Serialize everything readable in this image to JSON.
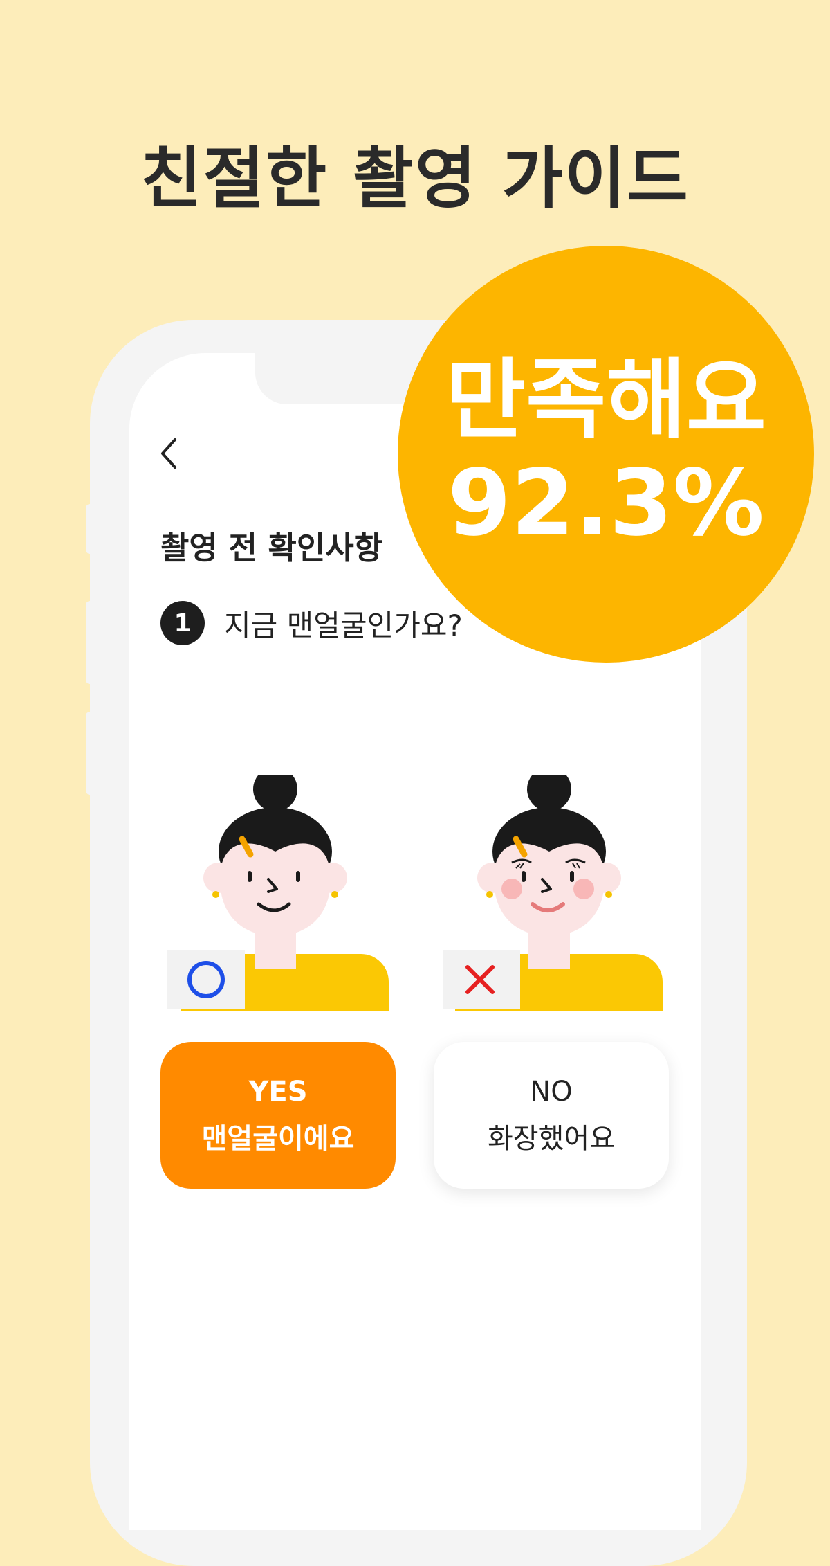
{
  "headline": "친절한 촬영 가이드",
  "badge": {
    "line1": "만족해요",
    "line2": "92.3%"
  },
  "screen": {
    "back_icon": "chevron-left-icon",
    "title": "촬영 전 확인사항",
    "question_number": "1",
    "question": "지금 맨얼굴인가요?",
    "examples": [
      {
        "mark": "circle-mark",
        "mark_color": "#1E4FE8"
      },
      {
        "mark": "x-mark",
        "mark_color": "#E62020"
      }
    ],
    "yes_button": {
      "line1": "YES",
      "line2": "맨얼굴이에요"
    },
    "no_button": {
      "line1": "NO",
      "line2": "화장했어요"
    }
  },
  "colors": {
    "background": "#FDEDBA",
    "badge": "#FDB500",
    "yes_button": "#FF8A00",
    "shirt": "#FBC804"
  }
}
